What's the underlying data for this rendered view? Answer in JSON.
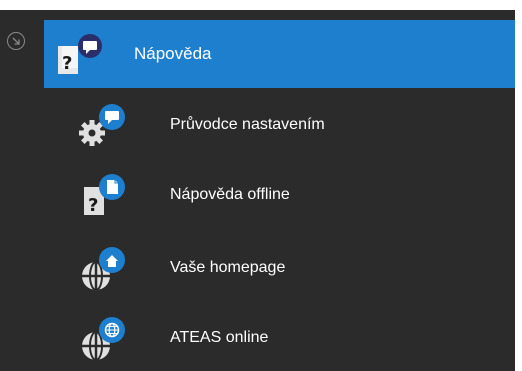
{
  "colors": {
    "panel_background": "#2b2b2b",
    "accent": "#1e7fce",
    "text": "#ffffff"
  },
  "menu": {
    "collapse_icon": "circle-arrow-down-right-icon",
    "header": {
      "label": "Nápověda",
      "icon": "help-book-chat-icon"
    },
    "items": [
      {
        "label": "Průvodce nastavením",
        "icon": "gear-chat-icon"
      },
      {
        "label": "Nápověda offline",
        "icon": "help-book-document-icon"
      },
      {
        "label": "Vaše homepage",
        "icon": "globe-home-icon"
      },
      {
        "label": "ATEAS online",
        "icon": "globe-web-icon"
      }
    ]
  }
}
